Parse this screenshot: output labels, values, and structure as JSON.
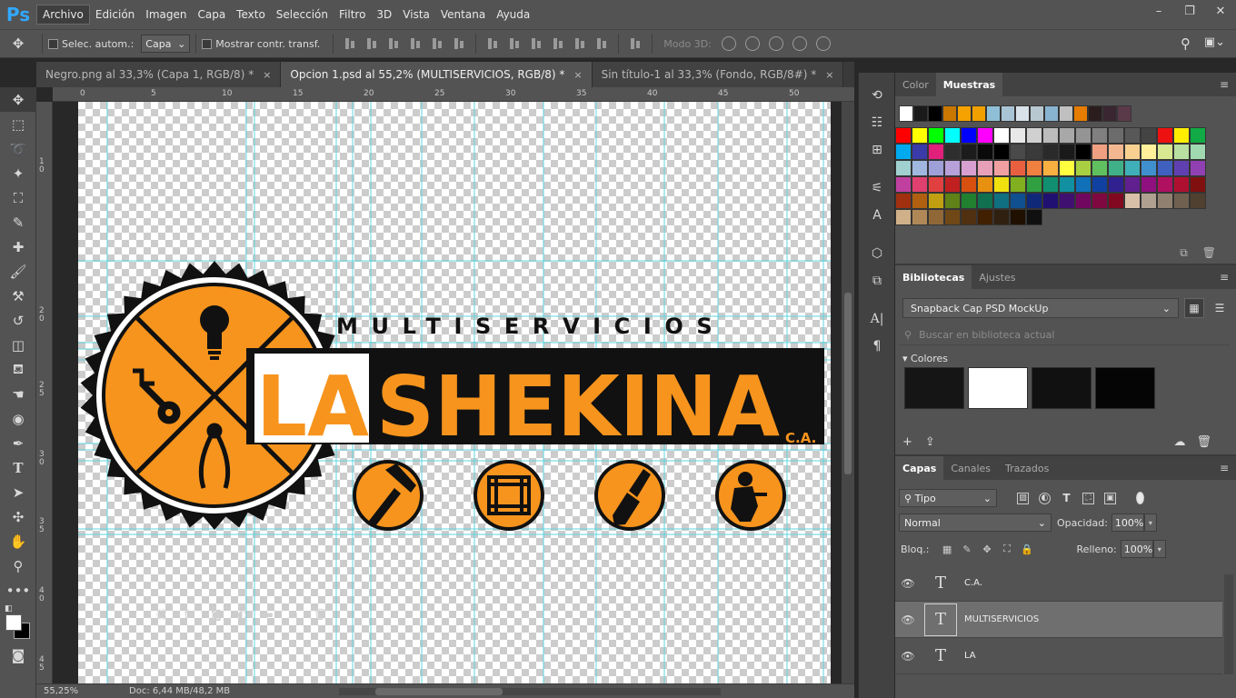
{
  "app": {
    "logo": "Ps"
  },
  "menu": [
    "Archivo",
    "Edición",
    "Imagen",
    "Capa",
    "Texto",
    "Selección",
    "Filtro",
    "3D",
    "Vista",
    "Ventana",
    "Ayuda"
  ],
  "window_controls": {
    "minimize": "–",
    "restore": "❐",
    "close": "✕"
  },
  "options": {
    "auto_select_label": "Selec. autom.:",
    "auto_select_target": "Capa",
    "show_transform_label": "Mostrar contr. transf.",
    "mode_3d_label": "Modo 3D:"
  },
  "tabs": [
    {
      "label": "Negro.png al 33,3% (Capa 1, RGB/8) *",
      "close": "×"
    },
    {
      "label": "Opcion 1.psd al 55,2% (MULTISERVICIOS, RGB/8) *",
      "close": "×"
    },
    {
      "label": "Sin título-1 al 33,3% (Fondo, RGB/8#) *",
      "close": "×"
    }
  ],
  "rulers": {
    "top": [
      "0",
      "5",
      "10",
      "15",
      "20",
      "25",
      "30",
      "35",
      "40",
      "45",
      "50"
    ],
    "left": [
      "1",
      "0",
      "2",
      "0",
      "2",
      "5",
      "3",
      "0",
      "3",
      "5",
      "4",
      "0",
      "4",
      "5"
    ]
  },
  "artwork": {
    "heading": "MULTISERVICIOS",
    "name_left": "LA",
    "name_right": "SHEKINA",
    "suffix": "C.A."
  },
  "status": {
    "zoom": "55,25%",
    "doc": "Doc: 6,44 MB/48,2 MB"
  },
  "swatches_panel": {
    "tabs": [
      "Color",
      "Muestras"
    ],
    "menu_icon": "≡",
    "recent": [
      "#ffffff",
      "#1a1a1a",
      "#000000",
      "#c87700",
      "#f5a100",
      "#f0a000",
      "#8fbfd6",
      "#a9c4d4",
      "#d9e2e8",
      "#b8c8d0",
      "#88b4d0",
      "#c0c0c0",
      "#e67c00",
      "#2b1d1d",
      "#3a2630",
      "#5a3a48"
    ],
    "grid": [
      "#ff0000",
      "#ffff00",
      "#00ff00",
      "#00ffff",
      "#0000ff",
      "#ff00ff",
      "#ffffff",
      "#e8e8e8",
      "#d0d0d0",
      "#bcbcbc",
      "#a8a8a8",
      "#949494",
      "#808080",
      "#6c6c6c",
      "#585858",
      "#444444",
      "#ee1111",
      "#ffee00",
      "#11aa44",
      "#00aaee",
      "#3a3aa8",
      "#e0207a",
      "#2e2e2e",
      "#1c1c1c",
      "#0a0a0a",
      "#000000",
      "#4a4a4a",
      "#3a3a3a",
      "#2a2a2a",
      "#1a1a1a",
      "#000000",
      "#f0a080",
      "#f4b890",
      "#f8d090",
      "#fff099",
      "#d8e890",
      "#b8e0a0",
      "#a0d8b0",
      "#a0d0d0",
      "#a0b8e0",
      "#a0a0d8",
      "#b8a0d8",
      "#d8a0d0",
      "#e8a0b8",
      "#f0a0a0",
      "#e86040",
      "#f08040",
      "#f8b040",
      "#ffff40",
      "#a8d040",
      "#60c060",
      "#40b088",
      "#40b0b8",
      "#4090d0",
      "#4060c0",
      "#6040b0",
      "#9040b0",
      "#c040a0",
      "#e04070",
      "#e04040",
      "#c02020",
      "#d85010",
      "#e89010",
      "#f0e010",
      "#80b020",
      "#30a040",
      "#109070",
      "#1090a0",
      "#1070b8",
      "#1040a0",
      "#302090",
      "#602090",
      "#901080",
      "#b01060",
      "#b01030",
      "#801010",
      "#a03010",
      "#b06010",
      "#c0a010",
      "#608018",
      "#208030",
      "#107050",
      "#107080",
      "#105090",
      "#102878",
      "#201070",
      "#401070",
      "#700860",
      "#800840",
      "#800820",
      "#d8c0a8",
      "#b0a090",
      "#908070",
      "#706050",
      "#504030",
      "#d0b088",
      "#b08858",
      "#906838",
      "#704818",
      "#503010",
      "#402000",
      "#302010",
      "#201000",
      "#101010"
    ],
    "footer_icons": [
      "new-swatch",
      "delete"
    ]
  },
  "libraries_panel": {
    "tabs": [
      "Bibliotecas",
      "Ajustes"
    ],
    "menu_icon": "≡",
    "selected_library": "Snapback Cap PSD MockUp",
    "search_placeholder": "Buscar en biblioteca actual",
    "colors_heading": "Colores",
    "colors": [
      "#151515",
      "#ffffff",
      "#111111",
      "#050505"
    ],
    "footer": {
      "add": "+",
      "upload": "⇪",
      "cc": "☁",
      "trash": "🗑"
    }
  },
  "layers_panel": {
    "tabs": [
      "Capas",
      "Canales",
      "Trazados"
    ],
    "menu_icon": "≡",
    "filter": "Tipo",
    "blend_mode": "Normal",
    "opacity_label": "Opacidad:",
    "opacity": "100%",
    "lock_label": "Bloq.:",
    "fill_label": "Relleno:",
    "fill": "100%",
    "layers": [
      {
        "name": "C.A.",
        "selected": false
      },
      {
        "name": "MULTISERVICIOS",
        "selected": true
      },
      {
        "name": "LA",
        "selected": false
      }
    ],
    "footer_icons": [
      "⛓",
      "fx",
      "◙",
      "◐",
      "▬",
      "⧉",
      "🗑"
    ]
  }
}
